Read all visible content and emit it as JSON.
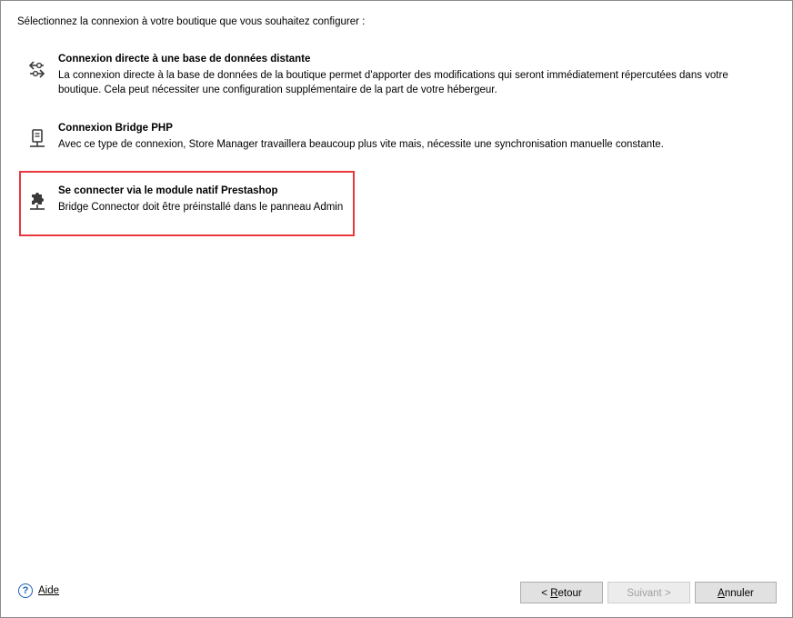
{
  "intro_text": "Sélectionnez la connexion à votre boutique que vous souhaitez configurer :",
  "options": [
    {
      "title": "Connexion directe à une base de données distante",
      "description": "La connexion directe à la base de données de la boutique permet d'apporter des modifications qui seront immédiatement répercutées dans votre boutique. Cela peut nécessiter une configuration supplémentaire de la part de votre hébergeur.",
      "icon": "sync-arrows-icon"
    },
    {
      "title": "Connexion Bridge PHP",
      "description": "Avec ce type de connexion, Store Manager travaillera beaucoup plus vite mais, nécessite une synchronisation manuelle constante.",
      "icon": "server-file-icon"
    },
    {
      "title": "Se connecter via le module natif Prestashop",
      "description": "Bridge Connector doit être préinstallé dans le panneau Admin",
      "icon": "puzzle-plugin-icon",
      "selected": true
    }
  ],
  "selection_color": "#e8383d",
  "footer": {
    "help_label": "Aide",
    "back_key": "<",
    "back_mnemonic": "R",
    "back_rest": "etour",
    "next_label": "Suivant >",
    "cancel_mnemonic": "A",
    "cancel_rest": "nnuler"
  }
}
